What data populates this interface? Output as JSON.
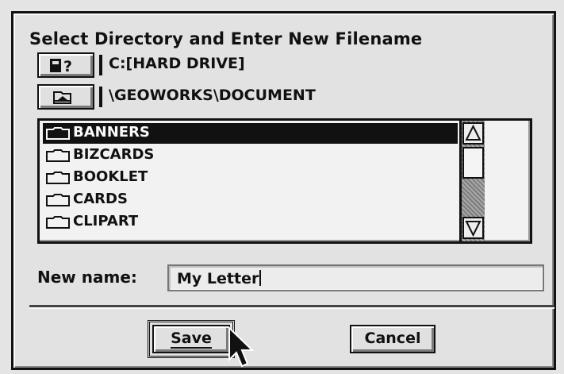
{
  "dialog": {
    "title": "Select Directory and Enter New Filename",
    "drive_label": "C:[HARD DRIVE]",
    "path_label": "\\GEOWORKS\\DOCUMENT",
    "drive_button_icon": "drive-query-icon",
    "up_button_icon": "open-parent-folder-icon"
  },
  "file_list": {
    "items": [
      "BANNERS",
      "BIZCARDS",
      "BOOKLET",
      "CARDS",
      "CLIPART"
    ],
    "selected": "BANNERS",
    "item_icon": "folder-icon"
  },
  "new_name": {
    "label": "New name:",
    "value": "My Letter"
  },
  "buttons": {
    "save": "Save",
    "cancel": "Cancel"
  },
  "colors": {
    "background": "#e2e2e2",
    "selection": "#111111"
  }
}
